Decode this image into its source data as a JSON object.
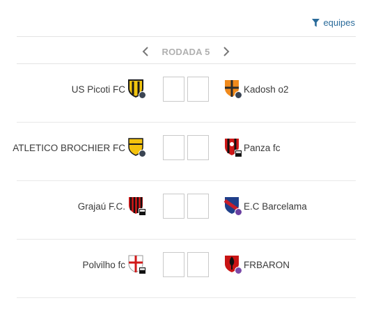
{
  "filter": {
    "label": "equipes",
    "icon": "filter-icon"
  },
  "round": {
    "label": "RODADA 5",
    "prev_icon": "chevron-left-icon",
    "next_icon": "chevron-right-icon"
  },
  "colors": {
    "accent": "#2a6b9a",
    "round_label": "#b0b0b0",
    "divider": "#e3e3e3",
    "score_border": "#c9c9c9"
  },
  "matches": [
    {
      "home": {
        "name": "US Picoti FC",
        "crest": "yellow-black-shield-crest"
      },
      "away": {
        "name": "Kadosh o2",
        "crest": "orange-black-shield-crest"
      },
      "home_score": "",
      "away_score": ""
    },
    {
      "home": {
        "name": "ATLETICO BROCHIER FC",
        "crest": "yellow-shield-crest"
      },
      "away": {
        "name": "Panza fc",
        "crest": "red-black-shield-crest"
      },
      "home_score": "",
      "away_score": ""
    },
    {
      "home": {
        "name": "Grajaú F.C.",
        "crest": "red-black-striped-shield-crest"
      },
      "away": {
        "name": "E.C Barcelama",
        "crest": "blue-red-shield-crest"
      },
      "home_score": "",
      "away_score": ""
    },
    {
      "home": {
        "name": "Polvilho fc",
        "crest": "white-red-cross-shield-crest"
      },
      "away": {
        "name": "FRBARON",
        "crest": "red-black-shield-crest"
      },
      "home_score": "",
      "away_score": ""
    }
  ]
}
